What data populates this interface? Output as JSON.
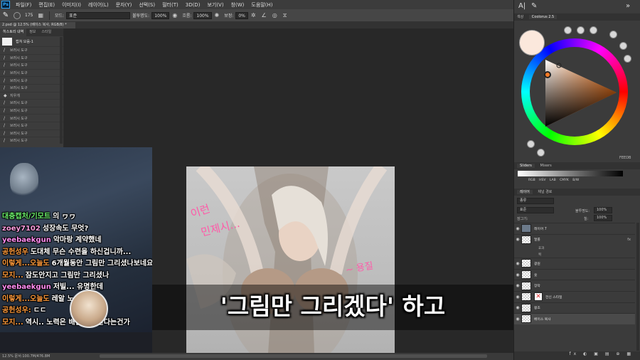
{
  "menubar": {
    "items": [
      "파일(F)",
      "편집(E)",
      "이미지(I)",
      "레이어(L)",
      "문자(Y)",
      "선택(S)",
      "필터(T)",
      "3D(D)",
      "보기(V)",
      "창(W)",
      "도움말(H)"
    ]
  },
  "options": {
    "brush_size": "175",
    "mode_label": "모드:",
    "mode_value": "표준",
    "opacity_label": "불투명도:",
    "opacity_value": "100%",
    "flow_label": "흐름:",
    "flow_value": "100%",
    "smoothing_label": "보정:",
    "smoothing_value": "0%"
  },
  "document_tab": "2.psd @ 12.5% (베이스 복사, RGB/8) *",
  "history": {
    "tabs": [
      "히스토리 내역",
      "정보",
      "스타일"
    ],
    "snapshot": "캡쳐 모음-1",
    "rows": [
      "브러시 도구",
      "브러시 도구",
      "브러시 도구",
      "브러시 도구",
      "브러시 도구",
      "브러시 도구",
      "지우개",
      "브러시 도구",
      "브러시 도구",
      "브러시 도구",
      "브러시 도구",
      "브러시 도구",
      "브러시 도구"
    ]
  },
  "chat": {
    "messages": [
      {
        "name": "대충캡처/기모트",
        "name_color": "#6cf06c",
        "text": "의 ヮヮ"
      },
      {
        "name": "zoey7102",
        "name_color": "#ff9de0",
        "text": "성장속도 무엇?"
      },
      {
        "name": "yeebaekgun",
        "name_color": "#ff8cf0",
        "text": "악마랑 계약했네"
      },
      {
        "name": "공헌성우",
        "name_color": "#ff9a3a",
        "text": "도대체 무슨 수련을 하신겁니까..."
      },
      {
        "name": "이렇게...오늘도",
        "name_color": "#ff9a3a",
        "text": "6개월동안 그림만 그리셨나보네요"
      },
      {
        "name": "모지...",
        "name_color": "#ff9a3a",
        "text": "잠도안지고 그림만 그리셨나"
      },
      {
        "name": "yeebaekgun",
        "name_color": "#ff8cf0",
        "text": "저빌...   유명한데"
      },
      {
        "name": "이렇게...오늘도",
        "name_color": "#ff9a3a",
        "text": "레알 노..."
      },
      {
        "name": "공헌성우:",
        "name_color": "#ff9a3a",
        "text": "ㄷㄷ"
      },
      {
        "name": "모지...",
        "name_color": "#ff9a3a",
        "text": "역시.. 노력은 배신을 안한다는건가"
      }
    ]
  },
  "subtitle": "'그림만 그리겠다' 하고",
  "statusbar": "12.5%    문서:100.7M/476.8M",
  "right": {
    "color_panel_tabs": [
      "색상",
      "Coolorus 2.5"
    ],
    "sliders_tabs": [
      "Sliders",
      "Mixers"
    ],
    "slider_modes": [
      "RGB",
      "HSV",
      "LAB",
      "CMYK",
      "B/W"
    ],
    "feedback": "FEEDB",
    "layers_tabs": [
      "레이어",
      "채널 경로"
    ],
    "kind_value": "종류",
    "blend_value": "표준",
    "opacity_label": "불투명도:",
    "opacity_value": "100%",
    "fill_label": "칠:",
    "fill_value": "100%",
    "lock_label": "잠그기:",
    "layers": [
      {
        "name": "레이어 7",
        "type": "group"
      },
      {
        "name": "얼룰",
        "type": "normal",
        "fx": "fx"
      },
      {
        "name": "효과",
        "type": "sub"
      },
      {
        "name": "획",
        "type": "sub"
      },
      {
        "name": "광원",
        "type": "normal"
      },
      {
        "name": "옷",
        "type": "normal"
      },
      {
        "name": "장막",
        "type": "normal"
      },
      {
        "name": "전신 스타일",
        "type": "mask"
      },
      {
        "name": "봉조",
        "type": "normal"
      },
      {
        "name": "베이스 복사",
        "type": "normal",
        "selected": true
      }
    ],
    "footer_icons": "fx ◐ ▣ ▤ ⊕ ▦"
  },
  "colors": {
    "foreground": "#fbe8dc",
    "ui_dark": "#282828"
  }
}
